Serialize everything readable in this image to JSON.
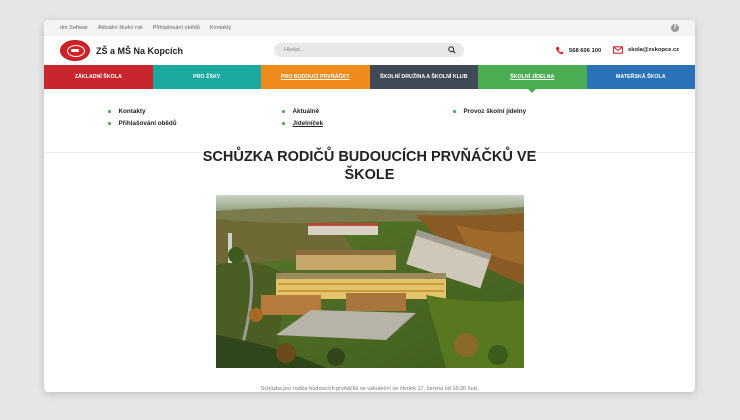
{
  "topbar": {
    "links": [
      "dm Softwar",
      "Aktuální školní rok",
      "Přihlašování obědů",
      "Kontakty"
    ]
  },
  "header": {
    "brand": "ZŠ a MŠ Na Kopcích",
    "search_placeholder": "Hledat...",
    "phone": "568 606 100",
    "email": "skola@zskopce.cz"
  },
  "nav": [
    {
      "label": "Základní škola",
      "color": "#c9252c"
    },
    {
      "label": "Pro žáky",
      "color": "#1ca9a0"
    },
    {
      "label": "Pro budoucí prvňáčky",
      "color": "#ef8a1d"
    },
    {
      "label": "Školní družina a školní klub",
      "color": "#3f4a56"
    },
    {
      "label": "Školní jídelna",
      "color": "#4aad52"
    },
    {
      "label": "Mateřská škola",
      "color": "#2a73b8"
    }
  ],
  "submenu": {
    "col1": [
      "Kontakty",
      "Přihlašování obědů"
    ],
    "col2": [
      "Aktuálně",
      "Jídelníček"
    ],
    "col3": [
      "Provoz školní jídelny"
    ]
  },
  "article": {
    "title": "SCHŮZKA RODIČŮ BUDOUCÍCH PRVŇÁČKŮ VE ŠKOLE",
    "text": "Schůzka pro rodiče budoucích prvňáčků se uskuteční ve čtvrtek 17. června od 16:30 hod."
  }
}
